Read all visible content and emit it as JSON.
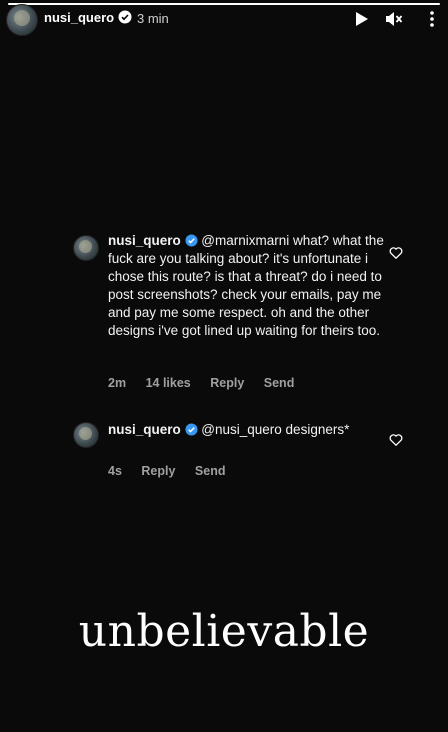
{
  "header": {
    "username": "nusi_quero",
    "time": "3 min",
    "play_icon": "play-icon",
    "mute_icon": "muted-speaker-icon",
    "more_icon": "more-dots-icon"
  },
  "comments": [
    {
      "username": "nusi_quero",
      "text": "@marnixmarni what? what the fuck are you talking about? it's unfortunate i chose this route? is that a threat? do i need to post screenshots? check your emails, pay me and pay me some respect. oh and the other designs i've got lined up waiting for theirs too.",
      "age": "2m",
      "likes": "14 likes",
      "reply": "Reply",
      "send": "Send"
    },
    {
      "username": "nusi_quero",
      "text": "@nusi_quero designers*",
      "age": "4s",
      "reply": "Reply",
      "send": "Send"
    }
  ],
  "sticker_text": "unbelievable",
  "colors": {
    "background": "#0a0a0a",
    "verified": "#3897f0",
    "meta": "#a0a0a0"
  }
}
